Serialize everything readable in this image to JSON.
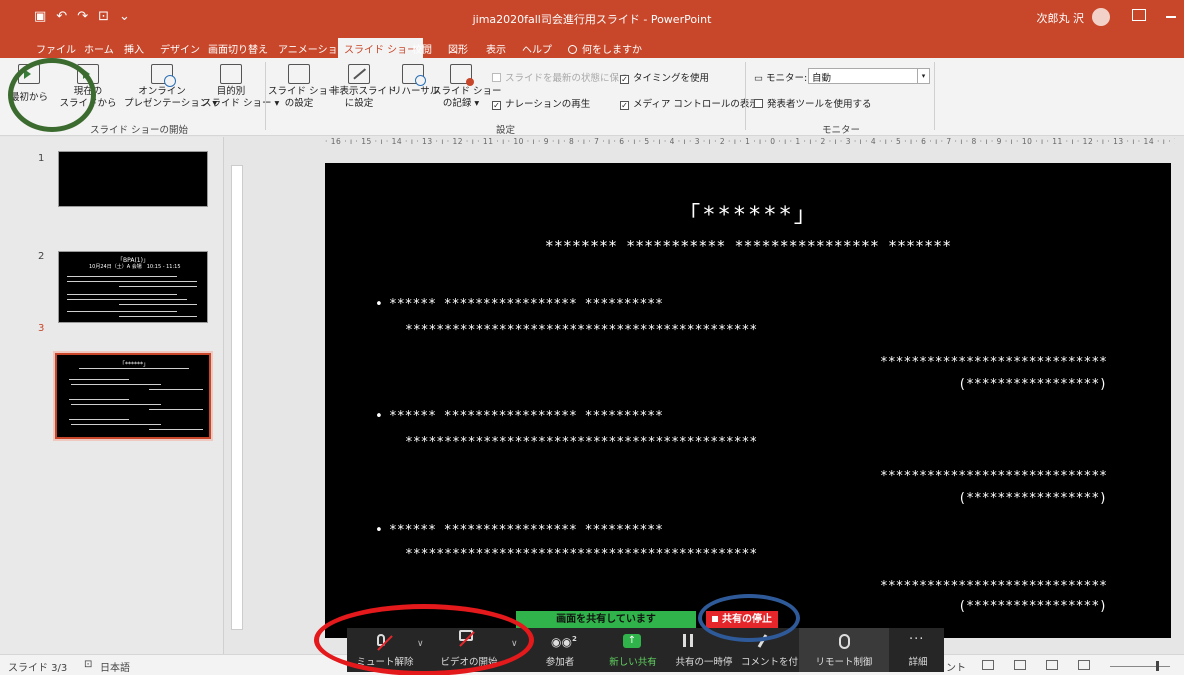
{
  "window": {
    "title": "jima2020fall司会進行用スライド  -  PowerPoint",
    "user": "次郎丸 沢"
  },
  "tabs": [
    "ファイル",
    "ホーム",
    "挿入",
    "デザイン",
    "画面切り替え",
    "アニメーション",
    "スライド ショー",
    "校閲",
    "図形",
    "表示",
    "ヘルプ"
  ],
  "active_tab": "スライド ショー",
  "tell_me": "何をしますか",
  "ribbon": {
    "start_group": {
      "label": "スライド ショーの開始",
      "from_beginning": "最初から",
      "from_current_1": "現在の",
      "from_current_2": "スライドから",
      "online_1": "オンライン",
      "online_2": "プレゼンテーション ▾",
      "custom_1": "目的別",
      "custom_2": "スライド ショー ▾"
    },
    "setup_group": {
      "label": "設定",
      "setup_1": "スライド ショー",
      "setup_2": "の設定",
      "hide_1": "非表示スライド",
      "hide_2": "に設定",
      "rehearse": "リハーサル",
      "record_1": "スライド ショー",
      "record_2": "の記録 ▾",
      "keep_updated": "スライドを最新の状態に保つ",
      "play_narration": "ナレーションの再生",
      "use_timings": "タイミングを使用",
      "media_controls": "メディア コントロールの表示"
    },
    "monitor_group": {
      "label": "モニター",
      "monitor_label": "モニター:",
      "monitor_value": "自動",
      "presenter_view": "発表者ツールを使用する"
    }
  },
  "thumbnails": {
    "numbers": [
      "1",
      "2",
      "3"
    ],
    "slide2_title": "「BPA(1)」",
    "slide2_sub": "10月24日（土）A 会場　10:15 - 11:15",
    "slide3_title": "「******」"
  },
  "ruler": {
    "horizontal": "· 16 · ı · 15 · ı · 14 · ı · 13 · ı · 12 · ı · 11 · ı · 10 · ı · 9 · ı · 8 · ı · 7 · ı · 6 · ı · 5 · ı · 4 · ı · 3 · ı · 2 · ı · 1 · ı · 0 · ı · 1 · ı · 2 · ı · 3 · ı · 4 · ı · 5 · ı · 6 · ı · 7 · ı · 8 · ı · 9 · ı · 10 · ı · 11 · ı · 12 · ı · 13 · ı · 14 · ı · 15 · ı · 16 ·"
  },
  "slide": {
    "title": "「******」",
    "subtitle": "******** *********** **************** *******",
    "items": [
      {
        "line1": "****** ***************** **********",
        "line2": "*********************************************",
        "presenter": "*****************************",
        "affiliation": "(*****************)"
      },
      {
        "line1": "****** ***************** **********",
        "line2": "*********************************************",
        "presenter": "*****************************",
        "affiliation": "(*****************)"
      },
      {
        "line1": "****** ***************** **********",
        "line2": "*********************************************",
        "presenter": "*****************************",
        "affiliation": "(*****************)"
      }
    ]
  },
  "status": {
    "slide_count": "スライド 3/3",
    "language": "日本語",
    "notes_partial": "ント"
  },
  "zoom": {
    "sharing_banner": "画面を共有しています",
    "stop_share": "共有の停止",
    "unmute": "ミュート解除",
    "start_video": "ビデオの開始",
    "participants": "参加者",
    "participant_count": "2",
    "new_share": "新しい共有",
    "pause_share": "共有の一時停",
    "annotate": "コメントを付",
    "remote_control": "リモート制御",
    "more": "詳細"
  },
  "colors": {
    "ppt_accent": "#c8472b",
    "zoom_green": "#2fb34a",
    "zoom_red": "#e5262b",
    "annotation_green": "#3c6b30",
    "annotation_red": "#e3191b",
    "annotation_blue": "#2f5a9a"
  }
}
